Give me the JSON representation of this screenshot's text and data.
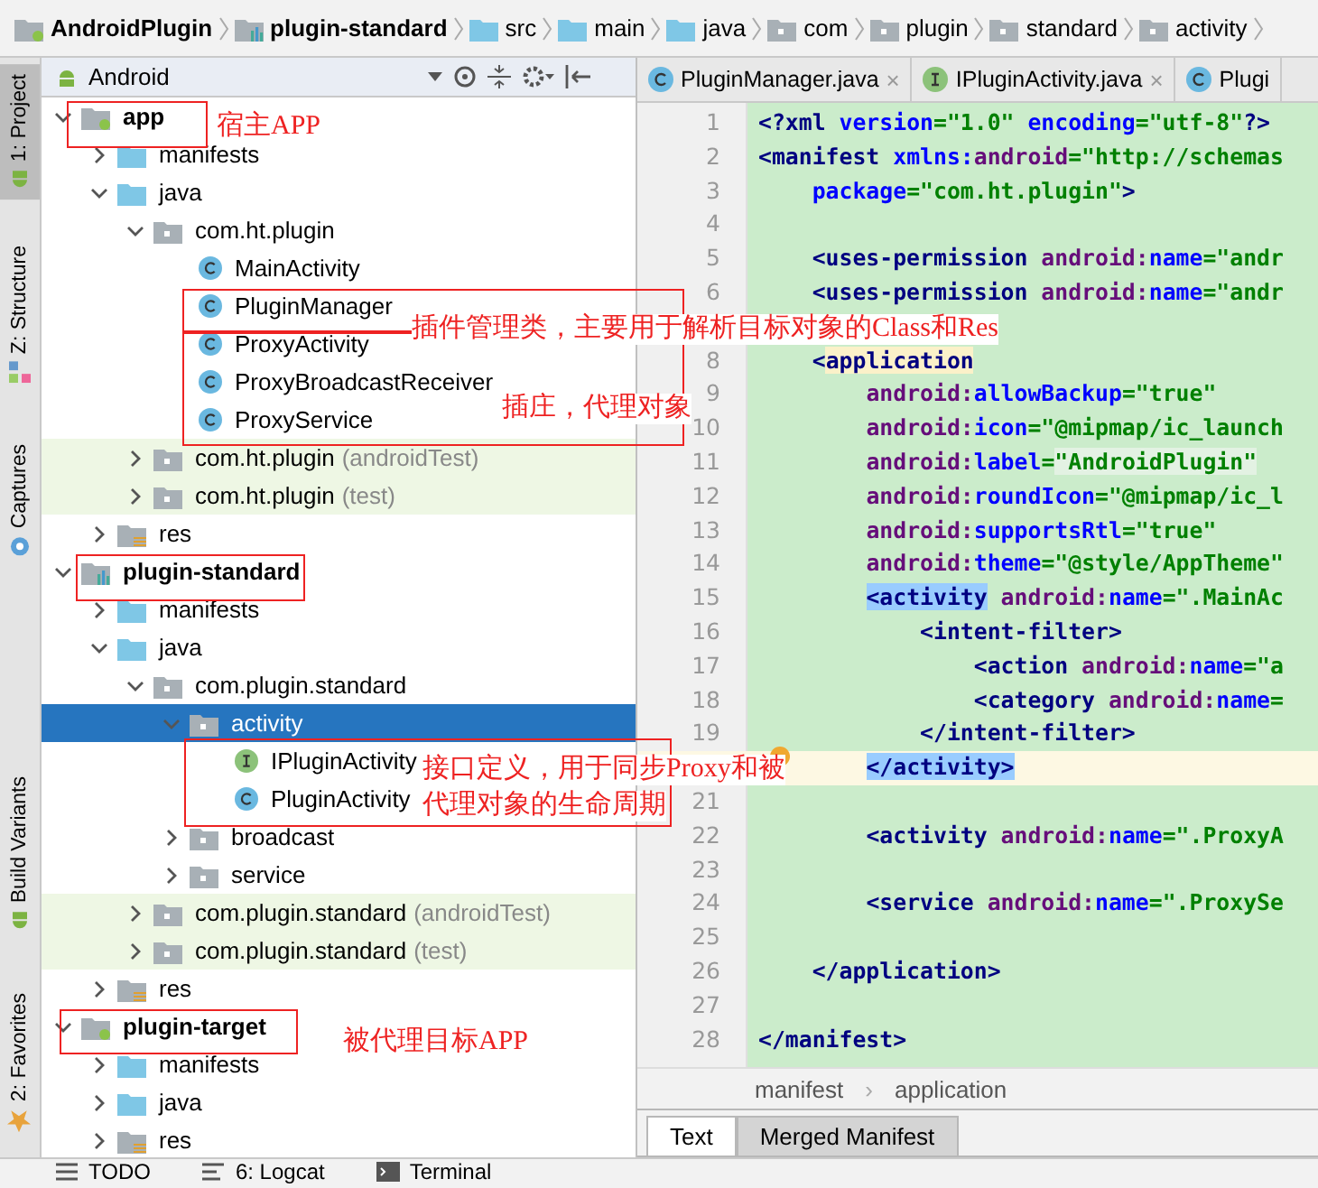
{
  "breadcrumb": [
    {
      "label": "AndroidPlugin",
      "kind": "project"
    },
    {
      "label": "plugin-standard",
      "kind": "module"
    },
    {
      "label": "src",
      "kind": "folder"
    },
    {
      "label": "main",
      "kind": "folder"
    },
    {
      "label": "java",
      "kind": "source"
    },
    {
      "label": "com",
      "kind": "package"
    },
    {
      "label": "plugin",
      "kind": "package"
    },
    {
      "label": "standard",
      "kind": "package"
    },
    {
      "label": "activity",
      "kind": "package"
    }
  ],
  "tool_strip": [
    {
      "label": "1: Project",
      "selected": true,
      "kind": "android"
    },
    {
      "label": "Z: Structure",
      "selected": false,
      "kind": "structure"
    },
    {
      "label": "Captures",
      "selected": false,
      "kind": "captures"
    },
    {
      "label": "Build Variants",
      "selected": false,
      "kind": "android"
    },
    {
      "label": "2: Favorites",
      "selected": false,
      "kind": "star"
    }
  ],
  "project_panel": {
    "view": "Android",
    "tree": [
      {
        "label": "app",
        "kind": "module_app",
        "expanded": true,
        "selected": false,
        "children": [
          {
            "label": "manifests",
            "kind": "folder",
            "expanded": false,
            "selected": false
          },
          {
            "label": "java",
            "kind": "folder",
            "expanded": true,
            "selected": false,
            "children": [
              {
                "label": "com.ht.plugin",
                "kind": "package",
                "expanded": true,
                "selected": false,
                "children": [
                  {
                    "label": "MainActivity",
                    "kind": "class",
                    "selected": false
                  },
                  {
                    "label": "PluginManager",
                    "kind": "class",
                    "selected": false
                  },
                  {
                    "label": "ProxyActivity",
                    "kind": "class",
                    "selected": false
                  },
                  {
                    "label": "ProxyBroadcastReceiver",
                    "kind": "class",
                    "selected": false
                  },
                  {
                    "label": "ProxyService",
                    "kind": "class",
                    "selected": false
                  }
                ]
              },
              {
                "label": "com.ht.plugin",
                "suffix": "(androidTest)",
                "kind": "package",
                "expanded": false,
                "selected": false
              },
              {
                "label": "com.ht.plugin",
                "suffix": "(test)",
                "kind": "package",
                "expanded": false,
                "selected": false
              }
            ]
          },
          {
            "label": "res",
            "kind": "res",
            "expanded": false,
            "selected": false
          }
        ]
      },
      {
        "label": "plugin-standard",
        "kind": "module_lib",
        "expanded": true,
        "selected": false,
        "children": [
          {
            "label": "manifests",
            "kind": "folder",
            "expanded": false,
            "selected": false
          },
          {
            "label": "java",
            "kind": "folder",
            "expanded": true,
            "selected": false,
            "children": [
              {
                "label": "com.plugin.standard",
                "kind": "package",
                "expanded": true,
                "selected": false,
                "children": [
                  {
                    "label": "activity",
                    "kind": "package",
                    "expanded": true,
                    "selected": true,
                    "children": [
                      {
                        "label": "IPluginActivity",
                        "kind": "interface",
                        "selected": false
                      },
                      {
                        "label": "PluginActivity",
                        "kind": "class",
                        "selected": false
                      }
                    ]
                  },
                  {
                    "label": "broadcast",
                    "kind": "package",
                    "expanded": false,
                    "selected": false
                  },
                  {
                    "label": "service",
                    "kind": "package",
                    "expanded": false,
                    "selected": false
                  }
                ]
              },
              {
                "label": "com.plugin.standard",
                "suffix": "(androidTest)",
                "kind": "package",
                "expanded": false,
                "selected": false
              },
              {
                "label": "com.plugin.standard",
                "suffix": "(test)",
                "kind": "package",
                "expanded": false,
                "selected": false
              }
            ]
          },
          {
            "label": "res",
            "kind": "res",
            "expanded": false,
            "selected": false
          }
        ]
      },
      {
        "label": "plugin-target",
        "kind": "module_app",
        "expanded": true,
        "selected": false,
        "children": [
          {
            "label": "manifests",
            "kind": "folder",
            "expanded": false,
            "selected": false
          },
          {
            "label": "java",
            "kind": "folder",
            "expanded": false,
            "selected": false
          },
          {
            "label": "res",
            "kind": "res",
            "expanded": false,
            "selected": false
          }
        ]
      }
    ]
  },
  "editor": {
    "tabs": [
      {
        "label": "PluginManager.java",
        "kind": "class",
        "close": "×"
      },
      {
        "label": "IPluginActivity.java",
        "kind": "interface",
        "close": "×"
      },
      {
        "label": "Plugi",
        "kind": "class"
      }
    ],
    "lines": [
      {
        "number": "1",
        "current": false,
        "tokens": [
          {
            "kind": "tag",
            "text": "<?xml "
          },
          {
            "kind": "attr",
            "text": "version"
          },
          {
            "kind": "value",
            "text": "=\"1.0\" "
          },
          {
            "kind": "attr",
            "text": "encoding"
          },
          {
            "kind": "value",
            "text": "=\"utf-8\""
          },
          {
            "kind": "tag",
            "text": "?>"
          }
        ]
      },
      {
        "number": "2",
        "current": false,
        "tokens": [
          {
            "kind": "tag",
            "text": "<manifest "
          },
          {
            "kind": "attr",
            "text": "xmlns:"
          },
          {
            "kind": "ns",
            "text": "android"
          },
          {
            "kind": "value",
            "text": "=\"http://schemas"
          }
        ]
      },
      {
        "number": "3",
        "current": false,
        "tokens": [
          {
            "kind": "attr",
            "text": "    package"
          },
          {
            "kind": "value",
            "text": "=\"com.ht.plugin\""
          },
          {
            "kind": "tag",
            "text": ">"
          }
        ]
      },
      {
        "number": "4",
        "current": false
      },
      {
        "number": "5",
        "current": false,
        "tokens": [
          {
            "kind": "tag",
            "text": "    <uses-permission "
          },
          {
            "kind": "ns",
            "text": "android:"
          },
          {
            "kind": "attr",
            "text": "name"
          },
          {
            "kind": "value",
            "text": "=\"andr"
          }
        ]
      },
      {
        "number": "6",
        "current": false,
        "tokens": [
          {
            "kind": "tag",
            "text": "    <uses-permission "
          },
          {
            "kind": "ns",
            "text": "android:"
          },
          {
            "kind": "attr",
            "text": "name"
          },
          {
            "kind": "value",
            "text": "=\"andr"
          }
        ]
      },
      {
        "current": false
      },
      {
        "number": "8",
        "current": false,
        "tokens": [
          {
            "kind": "tag",
            "text": "    <"
          },
          {
            "kind": "tag_caret",
            "text": "application"
          }
        ]
      },
      {
        "number": "9",
        "current": false,
        "tokens": [
          {
            "kind": "ns",
            "text": "        android:"
          },
          {
            "kind": "attr",
            "text": "allowBackup"
          },
          {
            "kind": "value",
            "text": "=\"true\""
          }
        ]
      },
      {
        "number": "10",
        "current": false,
        "tokens": [
          {
            "kind": "ns",
            "text": "        android:"
          },
          {
            "kind": "attr",
            "text": "icon"
          },
          {
            "kind": "value",
            "text": "=\"@mipmap/ic_launch"
          }
        ]
      },
      {
        "number": "11",
        "current": false,
        "tokens": [
          {
            "kind": "ns",
            "text": "        android:"
          },
          {
            "kind": "attr",
            "text": "label"
          },
          {
            "kind": "value",
            "text": "="
          },
          {
            "kind": "value_ref",
            "text": "\"AndroidPlugin\""
          }
        ]
      },
      {
        "number": "12",
        "current": false,
        "tokens": [
          {
            "kind": "ns",
            "text": "        android:"
          },
          {
            "kind": "attr",
            "text": "roundIcon"
          },
          {
            "kind": "value",
            "text": "=\"@mipmap/ic_l"
          }
        ]
      },
      {
        "number": "13",
        "current": false,
        "tokens": [
          {
            "kind": "ns",
            "text": "        android:"
          },
          {
            "kind": "attr",
            "text": "supportsRtl"
          },
          {
            "kind": "value",
            "text": "=\"true\""
          }
        ]
      },
      {
        "number": "14",
        "current": false,
        "tokens": [
          {
            "kind": "ns",
            "text": "        android:"
          },
          {
            "kind": "attr",
            "text": "theme"
          },
          {
            "kind": "value",
            "text": "=\"@style/AppTheme\""
          }
        ]
      },
      {
        "number": "15",
        "current": false,
        "tokens": [
          {
            "kind": "tag_match",
            "text": "        <activity"
          },
          {
            "kind": "ns",
            "text": " android:"
          },
          {
            "kind": "attr",
            "text": "name"
          },
          {
            "kind": "value",
            "text": "=\".MainAc"
          }
        ]
      },
      {
        "number": "16",
        "current": false,
        "tokens": [
          {
            "kind": "tag",
            "text": "            <intent-filter>"
          }
        ]
      },
      {
        "number": "17",
        "current": false,
        "tokens": [
          {
            "kind": "tag",
            "text": "                <action "
          },
          {
            "kind": "ns",
            "text": "android:"
          },
          {
            "kind": "attr",
            "text": "name"
          },
          {
            "kind": "value",
            "text": "=\"a"
          }
        ]
      },
      {
        "number": "18",
        "current": false,
        "tokens": [
          {
            "kind": "tag",
            "text": "                <category "
          },
          {
            "kind": "ns",
            "text": "android:"
          },
          {
            "kind": "attr",
            "text": "name"
          },
          {
            "kind": "value",
            "text": "="
          }
        ]
      },
      {
        "number": "19",
        "current": false,
        "tokens": [
          {
            "kind": "tag",
            "text": "            </intent-filter>"
          }
        ]
      },
      {
        "current": true,
        "tokens": [
          {
            "kind": "tag_match",
            "text": "        </activity>"
          }
        ]
      },
      {
        "number": "21",
        "current": false
      },
      {
        "number": "22",
        "current": false,
        "tokens": [
          {
            "kind": "tag",
            "text": "        <activity "
          },
          {
            "kind": "ns",
            "text": "android:"
          },
          {
            "kind": "attr",
            "text": "name"
          },
          {
            "kind": "value",
            "text": "=\".ProxyA"
          }
        ]
      },
      {
        "number": "23",
        "current": false
      },
      {
        "number": "24",
        "current": false,
        "tokens": [
          {
            "kind": "tag",
            "text": "        <service "
          },
          {
            "kind": "ns",
            "text": "android:"
          },
          {
            "kind": "attr",
            "text": "name"
          },
          {
            "kind": "value",
            "text": "=\".ProxySe"
          }
        ]
      },
      {
        "number": "25",
        "current": false
      },
      {
        "number": "26",
        "current": false,
        "tokens": [
          {
            "kind": "tag",
            "text": "    </application>"
          }
        ]
      },
      {
        "number": "27",
        "current": false
      },
      {
        "number": "28",
        "current": false,
        "tokens": [
          {
            "kind": "tag",
            "text": "</manifest>"
          }
        ]
      }
    ],
    "path": [
      "manifest",
      "application"
    ],
    "path_separator": "›",
    "bottom_tabs": [
      {
        "label": "Text",
        "selected": true
      },
      {
        "label": "Merged Manifest",
        "selected": false
      }
    ]
  },
  "bottom_bar": [
    {
      "label": "TODO",
      "kind": "todo"
    },
    {
      "label": "6: Logcat",
      "kind": "logcat"
    },
    {
      "label": "Terminal",
      "kind": "terminal"
    }
  ],
  "annotations": [
    "宿主APP",
    "插件管理类，主要用于解析目标对象的Class和Res",
    "插庄，代理对象",
    "接口定义，用于同步Proxy和被",
    "代理对象的生命周期",
    "被代理目标APP"
  ]
}
